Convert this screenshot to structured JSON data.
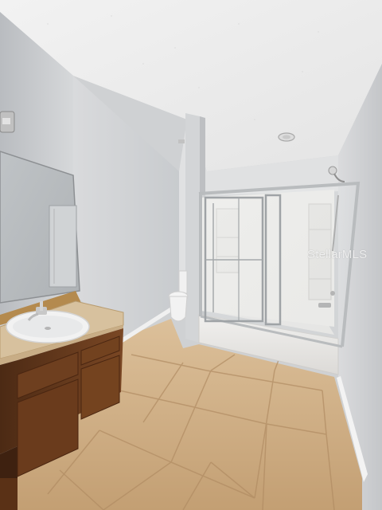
{
  "photo": {
    "subject": "bathroom",
    "watermark": "StellarMLS"
  },
  "colors": {
    "ceiling": "#eeeeee",
    "wall_left": "#c9ccd0",
    "wall_back": "#e1e2e3",
    "wall_right": "#d2d4d6",
    "floor_tile": "#c9ab82",
    "countertop": "#d6c09c",
    "cabinet": "#6b3d1f",
    "tub": "#ecebea"
  }
}
